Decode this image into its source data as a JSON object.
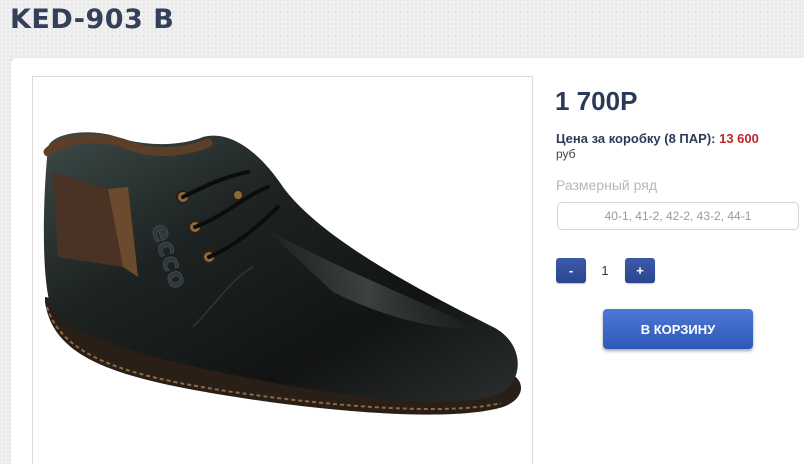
{
  "product": {
    "title": "KED-903 B",
    "price": "1 700Р",
    "box_price_label": "Цена за коробку (8 ПАР):",
    "box_price_value": "13 600",
    "currency": "руб",
    "size_label": "Размерный ряд",
    "size_value": "40-1, 41-2, 42-2, 43-2, 44-1",
    "image_logo_text": "ecco"
  },
  "quantity": {
    "minus_label": "-",
    "value": "1",
    "plus_label": "+"
  },
  "cart": {
    "button_label": "В КОРЗИНУ"
  },
  "colors": {
    "title": "#34405a",
    "accent_red": "#c1252b",
    "button_blue": "#2f57b8"
  }
}
